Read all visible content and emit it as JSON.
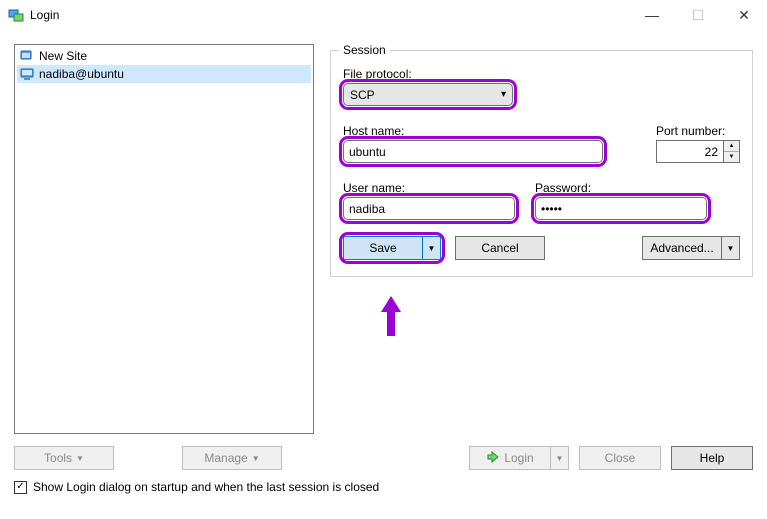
{
  "window": {
    "title": "Login"
  },
  "titlebar_buttons": {
    "minimize_glyph": "—",
    "maximize_glyph": "☐",
    "close_glyph": "✕"
  },
  "tree": {
    "items": [
      {
        "label": "New Site",
        "selected": false,
        "icon": "folder"
      },
      {
        "label": "nadiba@ubuntu",
        "selected": true,
        "icon": "pc"
      }
    ]
  },
  "session": {
    "legend": "Session",
    "file_protocol_label": "File protocol:",
    "file_protocol_value": "SCP",
    "host_label": "Host name:",
    "host_value": "ubuntu",
    "port_label": "Port number:",
    "port_value": "22",
    "user_label": "User name:",
    "user_value": "nadiba",
    "password_label": "Password:",
    "password_value": "•••••",
    "save_label": "Save",
    "cancel_label": "Cancel",
    "advanced_label": "Advanced..."
  },
  "bottom": {
    "tools_label": "Tools",
    "manage_label": "Manage",
    "login_label": "Login",
    "close_label": "Close",
    "help_label": "Help",
    "checkbox_label": "Show Login dialog on startup and when the last session is closed",
    "checkbox_checked_glyph": "✓"
  }
}
